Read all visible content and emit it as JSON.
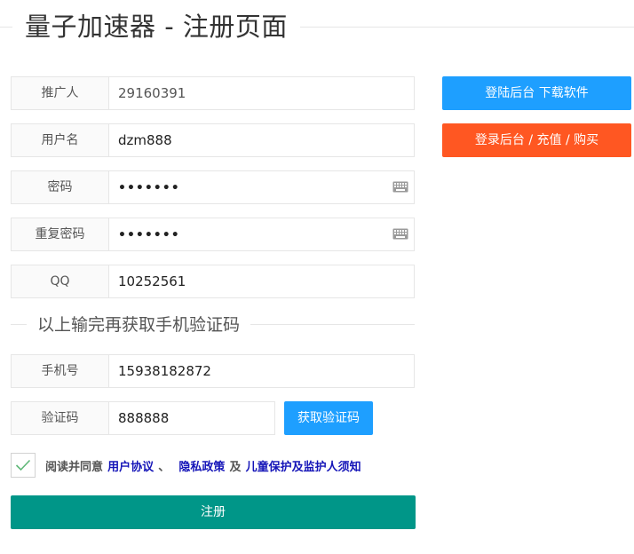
{
  "page": {
    "title": "量子加速器 - 注册页面"
  },
  "form": {
    "referrer": {
      "label": "推广人",
      "value": "29160391"
    },
    "username": {
      "label": "用户名",
      "value": "dzm888"
    },
    "password": {
      "label": "密码",
      "value": "•••••••"
    },
    "confirm_password": {
      "label": "重复密码",
      "value": "•••••••"
    },
    "qq": {
      "label": "QQ",
      "value": "10252561"
    },
    "section_title": "以上输完再获取手机验证码",
    "phone": {
      "label": "手机号",
      "value": "15938182872"
    },
    "code": {
      "label": "验证码",
      "value": "888888"
    },
    "get_code_label": "获取验证码",
    "agreement": {
      "prefix": "阅读并同意",
      "user_agreement": "用户协议",
      "separator": "、",
      "privacy_policy": "隐私政策",
      "and": "及",
      "child_notice": "儿童保护及监护人须知",
      "checked": true
    },
    "register_label": "注册"
  },
  "side_buttons": {
    "login_download": "登陆后台 下载软件",
    "login_recharge": "登录后台 / 充值 / 购买"
  },
  "colors": {
    "blue": "#1e9fff",
    "orange": "#ff5722",
    "teal": "#009688",
    "link": "#1515b8"
  },
  "icons": {
    "keyboard": "keyboard-icon",
    "check": "check-icon"
  }
}
